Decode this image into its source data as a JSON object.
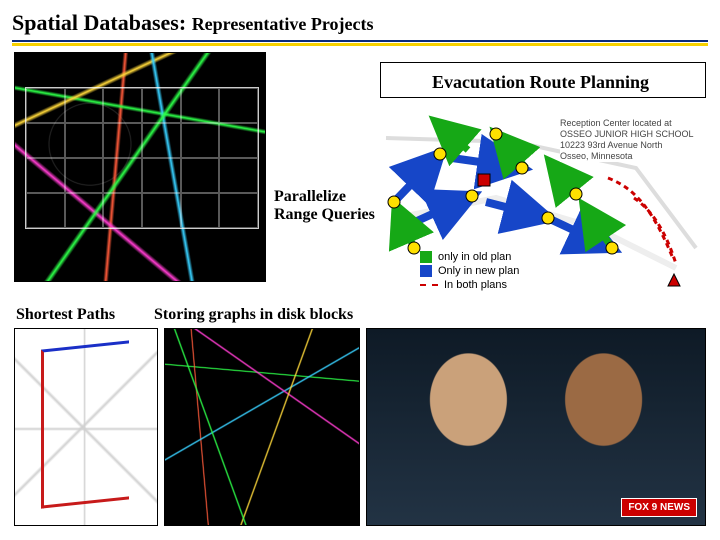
{
  "title": {
    "main": "Spatial Databases:",
    "sub": "Representative Projects"
  },
  "labels": {
    "range": "Parallelize\nRange Queries",
    "evac": "Evacutation Route Planning",
    "shortest": "Shortest Paths",
    "storing": "Storing graphs in disk blocks"
  },
  "legend": {
    "old": "only in old plan",
    "new": "Only in new plan",
    "both": "In both plans"
  },
  "reception_center": {
    "line1": "Reception Center located at",
    "line2": "OSSEO JUNIOR HIGH SCHOOL",
    "line3": "10223 93rd Avenue North",
    "line4": "Osseo, Minnesota"
  },
  "news": {
    "logo": "FOX 9 NEWS"
  }
}
